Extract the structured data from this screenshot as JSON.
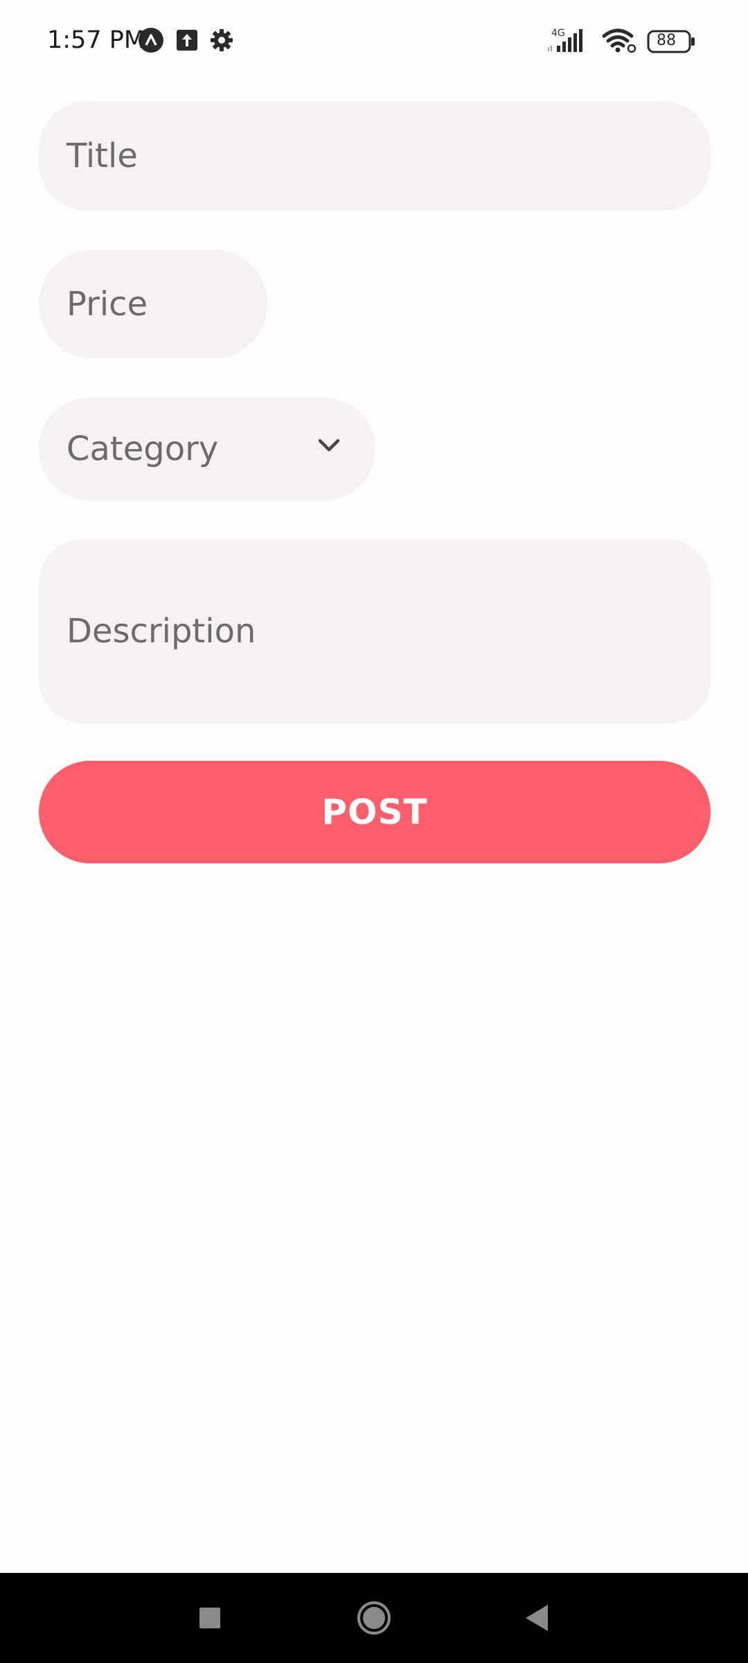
{
  "status_bar": {
    "time": "1:57 PM",
    "network": "4G",
    "battery": "88",
    "icons": [
      "assistant-icon",
      "upload-icon",
      "settings-gear-icon",
      "signal-icon",
      "wifi-icon",
      "battery-icon"
    ]
  },
  "form": {
    "title_placeholder": "Title",
    "price_placeholder": "Price",
    "category_placeholder": "Category",
    "description_placeholder": "Description",
    "post_label": "POST"
  },
  "colors": {
    "field_bg": "#f6f2f1",
    "placeholder": "#6f6a69",
    "accent": "#fd5e6b",
    "background": "#fefcfc"
  },
  "nav_bar": {
    "icons": [
      "recents-icon",
      "home-icon",
      "back-icon"
    ]
  }
}
